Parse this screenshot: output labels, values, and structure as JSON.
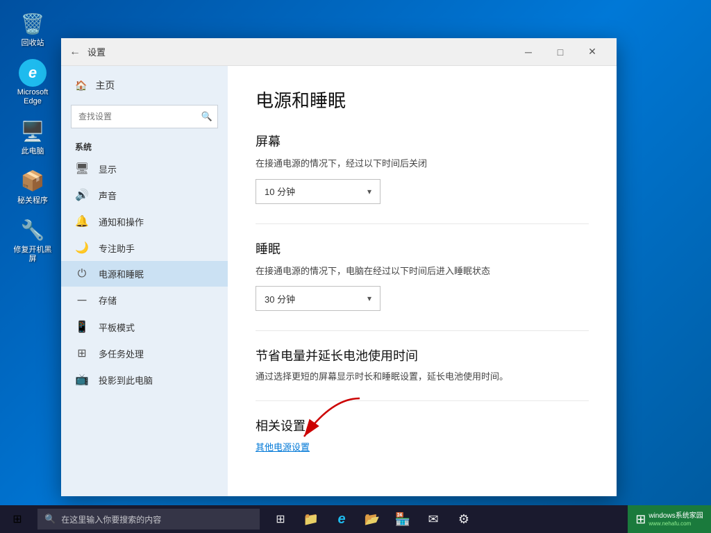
{
  "desktop": {
    "icons": [
      {
        "id": "recycle-bin",
        "label": "回收站",
        "icon": "🗑️"
      },
      {
        "id": "edge",
        "label": "Microsoft Edge",
        "icon": "🔵"
      },
      {
        "id": "this-pc",
        "label": "此电脑",
        "icon": "💻"
      },
      {
        "id": "secret-app",
        "label": "秘关程序",
        "icon": "📦"
      },
      {
        "id": "fix-app",
        "label": "修复开机黑屏",
        "icon": "🔧"
      }
    ]
  },
  "window": {
    "title": "设置",
    "back_label": "←",
    "minimize_label": "─",
    "maximize_label": "□",
    "close_label": "✕"
  },
  "sidebar": {
    "home_label": "主页",
    "search_placeholder": "查找设置",
    "section_label": "系统",
    "items": [
      {
        "id": "display",
        "icon": "🖥",
        "label": "显示"
      },
      {
        "id": "sound",
        "icon": "🔊",
        "label": "声音"
      },
      {
        "id": "notifications",
        "icon": "🔔",
        "label": "通知和操作"
      },
      {
        "id": "focus",
        "icon": "🌙",
        "label": "专注助手"
      },
      {
        "id": "power",
        "icon": "⏻",
        "label": "电源和睡眠",
        "active": true
      },
      {
        "id": "storage",
        "icon": "─",
        "label": "存储"
      },
      {
        "id": "tablet",
        "icon": "📱",
        "label": "平板模式"
      },
      {
        "id": "multitask",
        "icon": "⊞",
        "label": "多任务处理"
      },
      {
        "id": "project",
        "icon": "📺",
        "label": "投影到此电脑"
      }
    ]
  },
  "main": {
    "page_title": "电源和睡眠",
    "screen_section": {
      "title": "屏幕",
      "desc": "在接通电源的情况下，经过以下时间后关闭",
      "dropdown_value": "10 分钟"
    },
    "sleep_section": {
      "title": "睡眠",
      "desc": "在接通电源的情况下，电脑在经过以下时间后进入睡眠状态",
      "dropdown_value": "30 分钟"
    },
    "save_energy_section": {
      "title": "节省电量并延长电池使用时间",
      "desc": "通过选择更短的屏幕显示时长和睡眠设置，延长电池使用时间。"
    },
    "related_section": {
      "title": "相关设置",
      "link_label": "其他电源设置"
    }
  },
  "taskbar": {
    "search_placeholder": "在这里输入你要搜索的内容",
    "apps": [
      {
        "id": "task-view",
        "icon": "⊞"
      },
      {
        "id": "file-explorer",
        "icon": "📁"
      },
      {
        "id": "edge-app",
        "icon": "e"
      },
      {
        "id": "explorer-app",
        "icon": "📂"
      },
      {
        "id": "store-app",
        "icon": "🏪"
      },
      {
        "id": "mail-app",
        "icon": "✉"
      },
      {
        "id": "settings-app",
        "icon": "⚙"
      }
    ],
    "right_icons": [
      {
        "id": "night-mode",
        "icon": "🌙"
      },
      {
        "id": "task-manager",
        "icon": "⊟"
      },
      {
        "id": "edge-right",
        "icon": "e"
      }
    ]
  },
  "brand": {
    "logo": "⊞",
    "name": "windows系统家园",
    "url": "www.nehafu.com"
  }
}
